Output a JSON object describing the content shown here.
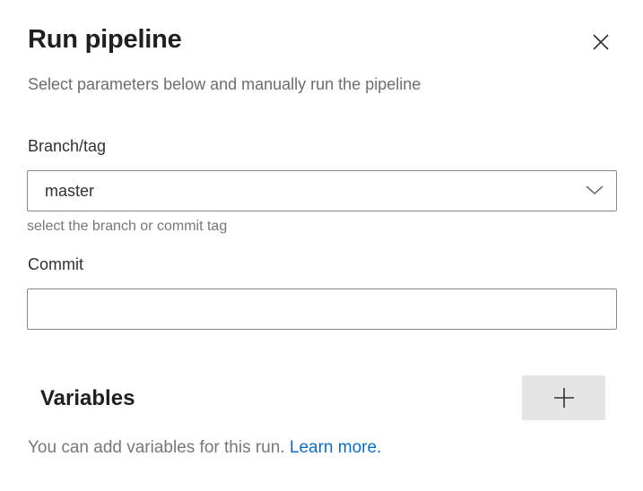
{
  "dialog": {
    "title": "Run pipeline",
    "subtitle": "Select parameters below and manually run the pipeline",
    "close_icon": "close-icon"
  },
  "branch": {
    "label": "Branch/tag",
    "value": "master",
    "helper": "select the branch or commit tag",
    "chevron_icon": "chevron-down-icon"
  },
  "commit": {
    "label": "Commit",
    "value": "",
    "placeholder": ""
  },
  "variables": {
    "title": "Variables",
    "add_icon": "plus-icon",
    "description": "You can add variables for this run.",
    "link_text": "Learn more."
  },
  "colors": {
    "link": "#0f6cbd",
    "add_button_bg": "#e5e5e5",
    "border": "#8a8886"
  }
}
